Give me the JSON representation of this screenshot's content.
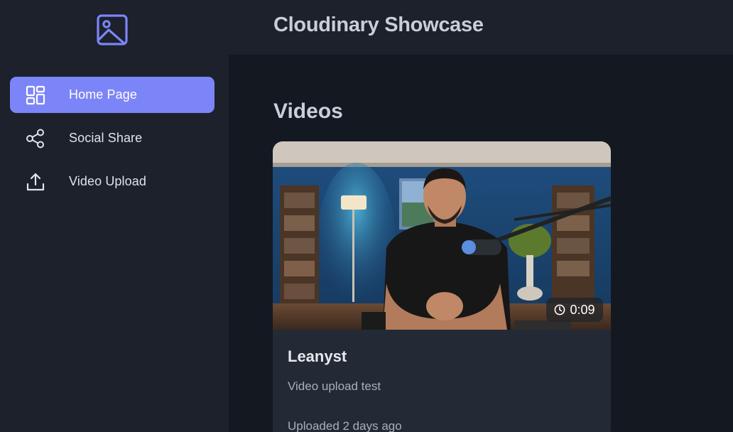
{
  "app": {
    "title": "Cloudinary Showcase",
    "accent_color": "#7c85f7",
    "logo_icon": "image-icon"
  },
  "sidebar": {
    "items": [
      {
        "label": "Home Page",
        "icon": "dashboard-icon",
        "active": true
      },
      {
        "label": "Social Share",
        "icon": "share-icon",
        "active": false
      },
      {
        "label": "Video Upload",
        "icon": "upload-icon",
        "active": false
      }
    ]
  },
  "main": {
    "section_title": "Videos",
    "videos": [
      {
        "title": "Leanyst",
        "description": "Video upload test",
        "uploaded": "Uploaded 2 days ago",
        "duration": "0:09"
      }
    ]
  }
}
